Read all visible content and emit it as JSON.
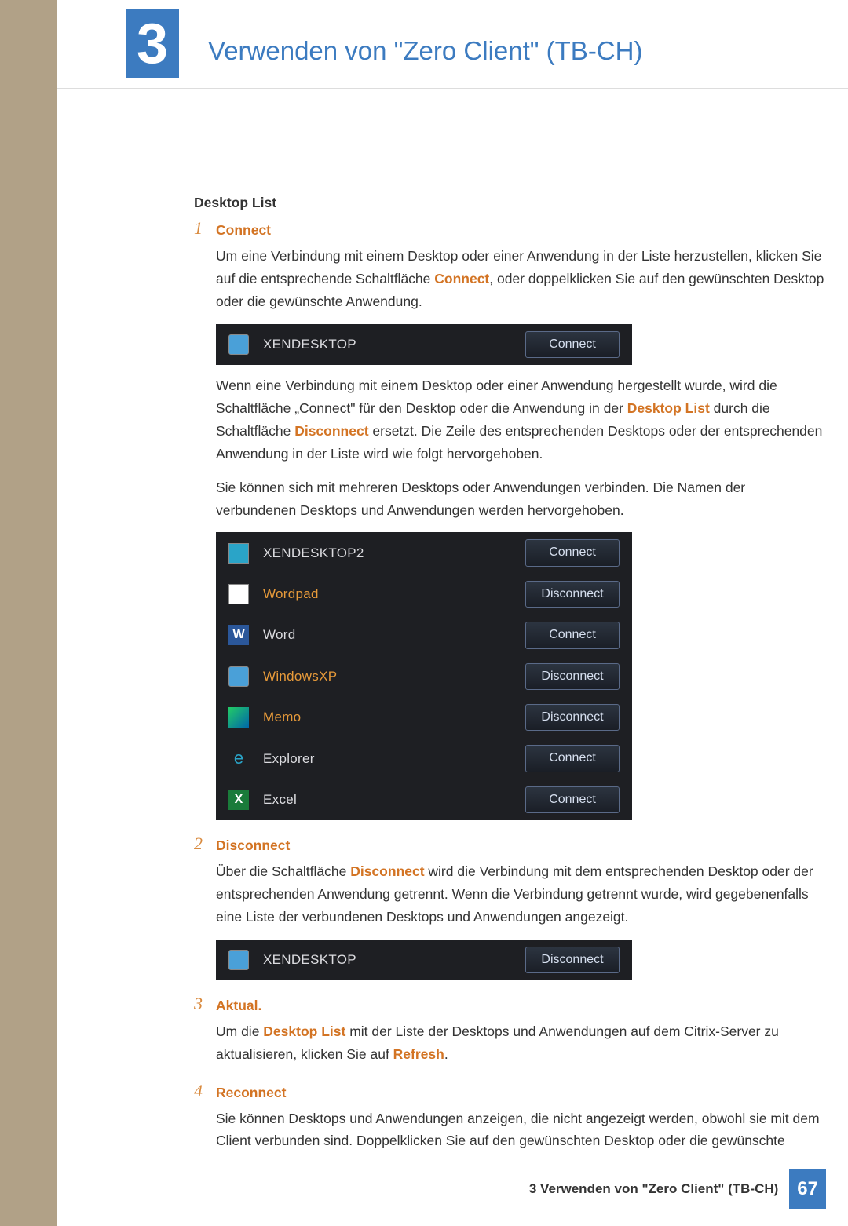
{
  "header": {
    "chapter_number": "3",
    "chapter_title": "Verwenden von \"Zero Client\" (TB-CH)"
  },
  "section_title": "Desktop List",
  "items": [
    {
      "num": "1",
      "head": "Connect",
      "para1_a": "Um eine Verbindung mit einem Desktop oder einer Anwendung in der Liste herzustellen, klicken Sie auf die entsprechende Schaltfläche ",
      "para1_hl": "Connect",
      "para1_b": ", oder doppelklicken Sie auf den gewünschten Desktop oder die gewünschte Anwendung.",
      "panel_single": {
        "label": "XENDESKTOP",
        "button": "Connect",
        "icon": "ic-generic"
      },
      "para2_a": "Wenn eine Verbindung mit einem Desktop oder einer Anwendung hergestellt wurde, wird die Schaltfläche „Connect\" für den Desktop oder die Anwendung in der ",
      "para2_hl1": "Desktop List",
      "para2_b": " durch die Schaltfläche ",
      "para2_hl2": "Disconnect",
      "para2_c": " ersetzt. Die Zeile des entsprechenden Desktops oder der entsprechenden Anwendung in der Liste wird wie folgt hervorgehoben.",
      "para3": "Sie können sich mit mehreren Desktops oder Anwendungen verbinden. Die Namen der verbundenen Desktops und Anwendungen werden hervorgehoben.",
      "panel_multi": [
        {
          "label": "XENDESKTOP2",
          "button": "Connect",
          "active": false,
          "icon": "ic-pict",
          "glyph": ""
        },
        {
          "label": "Wordpad",
          "button": "Disconnect",
          "active": true,
          "icon": "ic-wp",
          "glyph": ""
        },
        {
          "label": "Word",
          "button": "Connect",
          "active": false,
          "icon": "ic-w",
          "glyph": "W"
        },
        {
          "label": "WindowsXP",
          "button": "Disconnect",
          "active": true,
          "icon": "ic-xp",
          "glyph": ""
        },
        {
          "label": "Memo",
          "button": "Disconnect",
          "active": true,
          "icon": "ic-memo",
          "glyph": ""
        },
        {
          "label": "Explorer",
          "button": "Connect",
          "active": false,
          "icon": "ic-ie",
          "glyph": "e"
        },
        {
          "label": "Excel",
          "button": "Connect",
          "active": false,
          "icon": "ic-x",
          "glyph": "X"
        }
      ]
    },
    {
      "num": "2",
      "head": "Disconnect",
      "para1_a": "Über die Schaltfläche ",
      "para1_hl": "Disconnect",
      "para1_b": " wird die Verbindung mit dem entsprechenden Desktop oder der entsprechenden Anwendung getrennt. Wenn die Verbindung getrennt wurde, wird gegebenenfalls eine Liste der verbundenen Desktops und Anwendungen angezeigt.",
      "panel_single": {
        "label": "XENDESKTOP",
        "button": "Disconnect",
        "icon": "ic-generic"
      }
    },
    {
      "num": "3",
      "head": "Aktual.",
      "para1_a": "Um die ",
      "para1_hl1": "Desktop List",
      "para1_b": " mit der Liste der Desktops und Anwendungen auf dem Citrix-Server zu aktualisieren, klicken Sie auf ",
      "para1_hl2": "Refresh",
      "para1_c": "."
    },
    {
      "num": "4",
      "head": "Reconnect",
      "para1": "Sie können Desktops und Anwendungen anzeigen, die nicht angezeigt werden, obwohl sie mit dem Client verbunden sind. Doppelklicken Sie auf den gewünschten Desktop oder die gewünschte"
    }
  ],
  "footer": {
    "text": "3 Verwenden von \"Zero Client\" (TB-CH)",
    "page": "67"
  }
}
